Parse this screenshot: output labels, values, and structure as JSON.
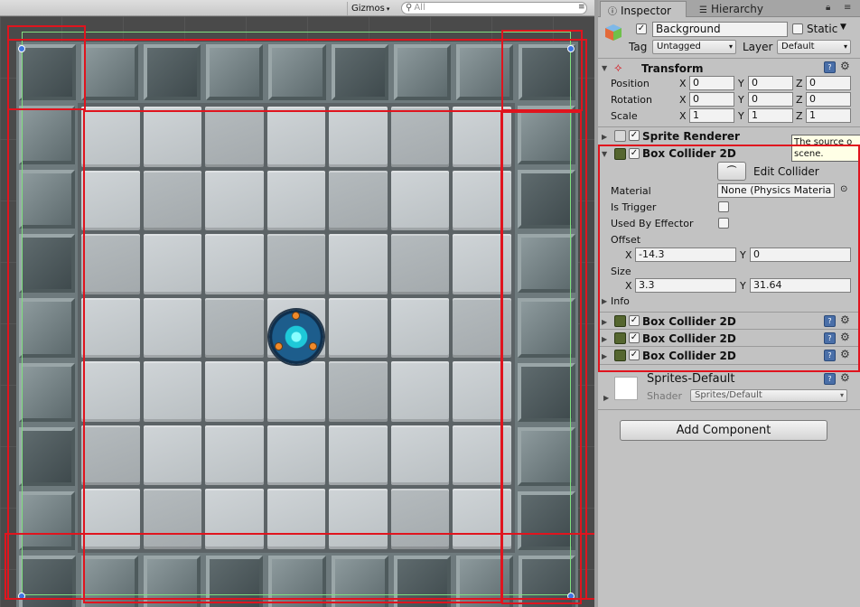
{
  "scene": {
    "gizmos_label": "Gizmos",
    "search_placeholder": "All"
  },
  "inspector": {
    "tabs": [
      {
        "label": "Inspector",
        "icon": "info-icon"
      },
      {
        "label": "Hierarchy",
        "icon": "hierarchy-icon"
      }
    ],
    "object": {
      "name": "Background",
      "active": true,
      "static_label": "Static",
      "static": false,
      "tag_label": "Tag",
      "tag_value": "Untagged",
      "layer_label": "Layer",
      "layer_value": "Default"
    },
    "transform": {
      "title": "Transform",
      "position_label": "Position",
      "rotation_label": "Rotation",
      "scale_label": "Scale",
      "axis_labels": [
        "X",
        "Y",
        "Z"
      ],
      "position": [
        "0",
        "0",
        "0"
      ],
      "rotation": [
        "0",
        "0",
        "0"
      ],
      "scale": [
        "1",
        "1",
        "1"
      ]
    },
    "sprite_renderer": {
      "title": "Sprite Renderer"
    },
    "tooltip": {
      "line1": "The source o",
      "line2": "scene."
    },
    "box_collider": {
      "title": "Box Collider 2D",
      "edit_collider_label": "Edit Collider",
      "material_label": "Material",
      "material_value": "None (Physics Materia",
      "is_trigger_label": "Is Trigger",
      "used_by_effector_label": "Used By Effector",
      "offset_label": "Offset",
      "offset_x": "-14.3",
      "offset_y": "0",
      "size_label": "Size",
      "size_x": "3.3",
      "size_y": "31.64",
      "info_label": "Info",
      "axis_x": "X",
      "axis_y": "Y"
    },
    "collapsed_colliders": [
      "Box Collider 2D",
      "Box Collider 2D",
      "Box Collider 2D"
    ],
    "material": {
      "name": "Sprites-Default",
      "shader_label": "Shader",
      "shader_value": "Sprites/Default"
    },
    "add_component_label": "Add Component"
  },
  "colors": {
    "annotation_red": "#e0141e",
    "collider_green": "#7fe07f",
    "handle_blue": "#3d74e0"
  }
}
